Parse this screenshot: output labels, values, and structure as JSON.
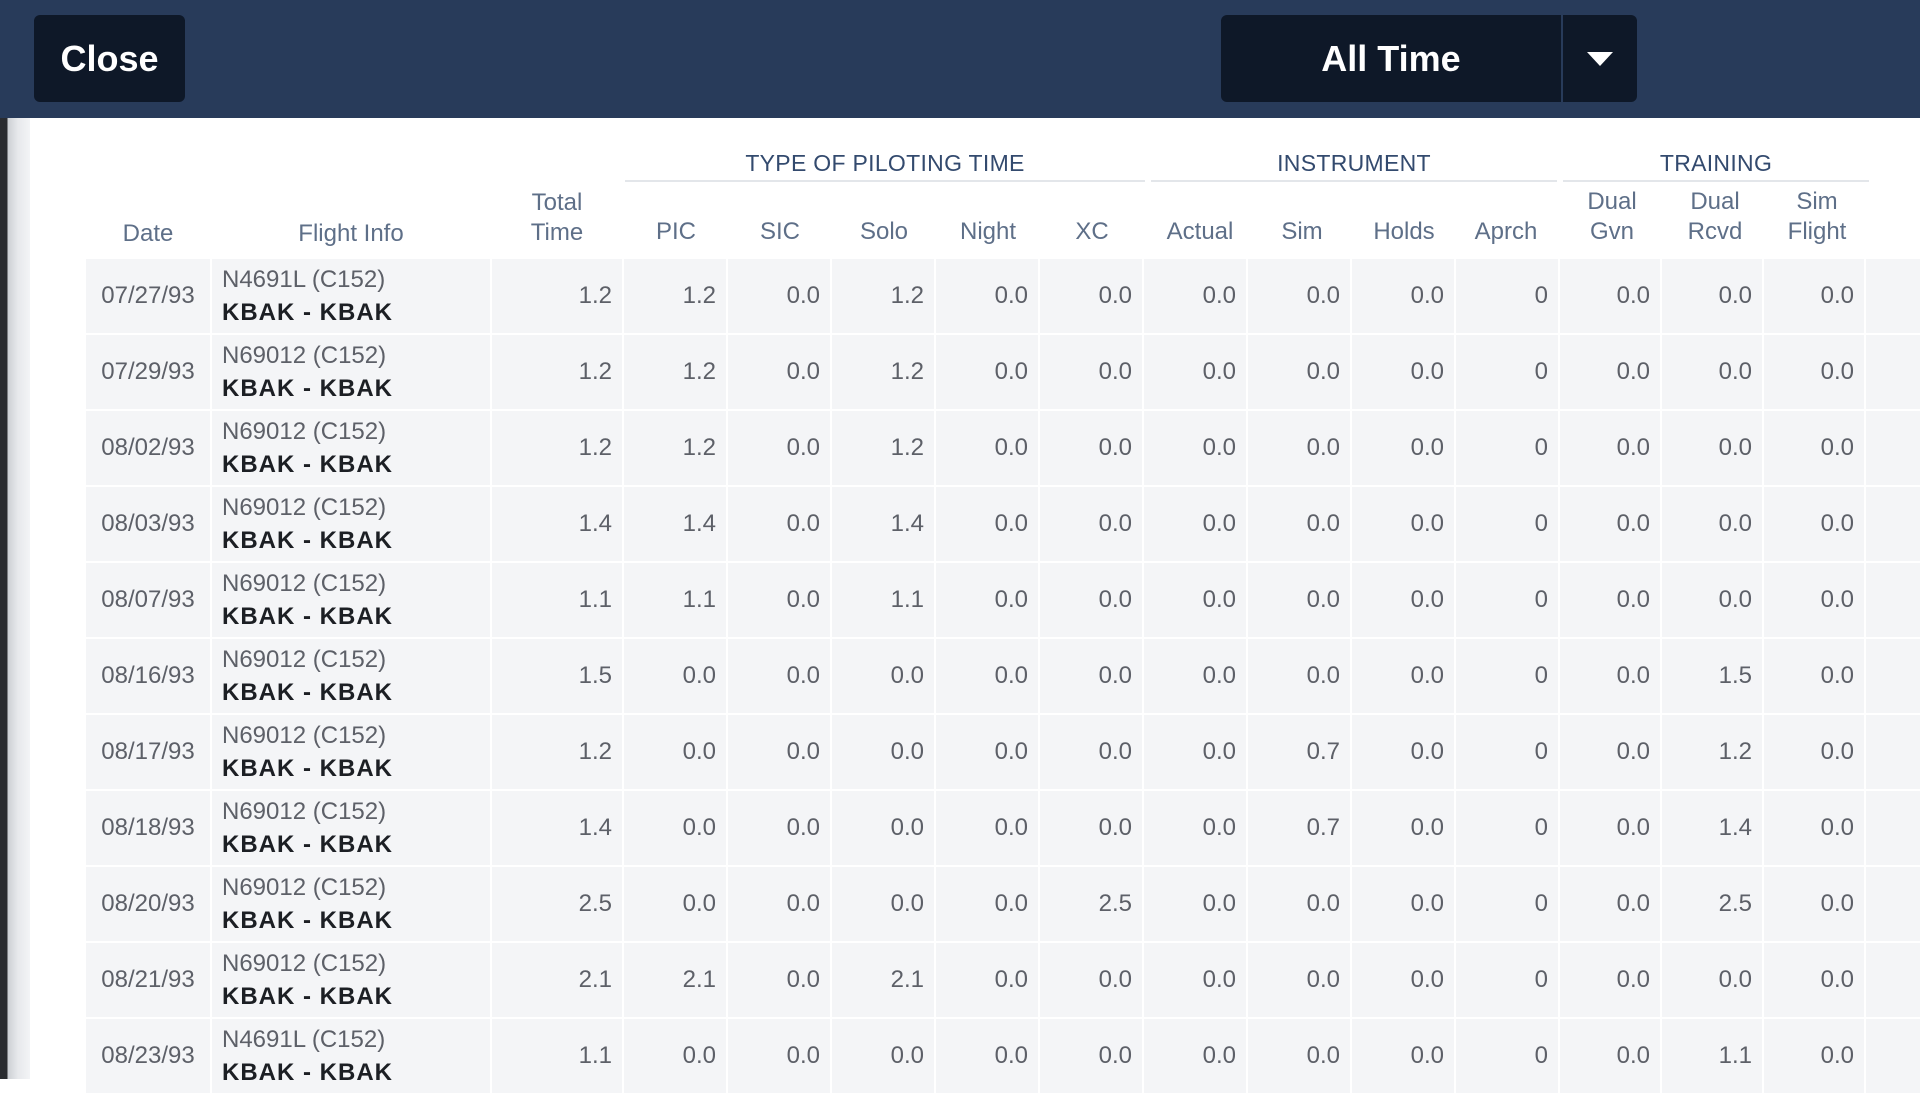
{
  "toolbar": {
    "close_label": "Close",
    "range_value": "All Time"
  },
  "colors": {
    "toolbar_bg": "#283b5a",
    "button_bg": "#0e1828",
    "header_text": "#334a6e",
    "row_bg": "#f4f5f7"
  },
  "groups": {
    "piloting": "TYPE OF PILOTING TIME",
    "instrument": "INSTRUMENT",
    "training": "TRAINING"
  },
  "columns": {
    "date": "Date",
    "flight_info": "Flight Info",
    "total_1": "Total",
    "total_2": "Time",
    "pic": "PIC",
    "sic": "SIC",
    "solo": "Solo",
    "night": "Night",
    "xc": "XC",
    "actual": "Actual",
    "sim": "Sim",
    "holds": "Holds",
    "aprch": "Aprch",
    "dual_gvn_1": "Dual",
    "dual_gvn_2": "Gvn",
    "dual_rcvd_1": "Dual",
    "dual_rcvd_2": "Rcvd",
    "sim_flight_1": "Sim",
    "sim_flight_2": "Flight"
  },
  "rows": [
    {
      "date": "07/27/93",
      "aircraft": "N4691L (C152)",
      "route": "KBAK - KBAK",
      "total": "1.2",
      "pic": "1.2",
      "sic": "0.0",
      "solo": "1.2",
      "night": "0.0",
      "xc": "0.0",
      "actual": "0.0",
      "sim": "0.0",
      "holds": "0.0",
      "aprch": "0",
      "dual_gvn": "0.0",
      "dual_rcvd": "0.0",
      "sim_flight": "0.0"
    },
    {
      "date": "07/29/93",
      "aircraft": "N69012 (C152)",
      "route": "KBAK - KBAK",
      "total": "1.2",
      "pic": "1.2",
      "sic": "0.0",
      "solo": "1.2",
      "night": "0.0",
      "xc": "0.0",
      "actual": "0.0",
      "sim": "0.0",
      "holds": "0.0",
      "aprch": "0",
      "dual_gvn": "0.0",
      "dual_rcvd": "0.0",
      "sim_flight": "0.0"
    },
    {
      "date": "08/02/93",
      "aircraft": "N69012 (C152)",
      "route": "KBAK - KBAK",
      "total": "1.2",
      "pic": "1.2",
      "sic": "0.0",
      "solo": "1.2",
      "night": "0.0",
      "xc": "0.0",
      "actual": "0.0",
      "sim": "0.0",
      "holds": "0.0",
      "aprch": "0",
      "dual_gvn": "0.0",
      "dual_rcvd": "0.0",
      "sim_flight": "0.0"
    },
    {
      "date": "08/03/93",
      "aircraft": "N69012 (C152)",
      "route": "KBAK - KBAK",
      "total": "1.4",
      "pic": "1.4",
      "sic": "0.0",
      "solo": "1.4",
      "night": "0.0",
      "xc": "0.0",
      "actual": "0.0",
      "sim": "0.0",
      "holds": "0.0",
      "aprch": "0",
      "dual_gvn": "0.0",
      "dual_rcvd": "0.0",
      "sim_flight": "0.0"
    },
    {
      "date": "08/07/93",
      "aircraft": "N69012 (C152)",
      "route": "KBAK - KBAK",
      "total": "1.1",
      "pic": "1.1",
      "sic": "0.0",
      "solo": "1.1",
      "night": "0.0",
      "xc": "0.0",
      "actual": "0.0",
      "sim": "0.0",
      "holds": "0.0",
      "aprch": "0",
      "dual_gvn": "0.0",
      "dual_rcvd": "0.0",
      "sim_flight": "0.0"
    },
    {
      "date": "08/16/93",
      "aircraft": "N69012 (C152)",
      "route": "KBAK - KBAK",
      "total": "1.5",
      "pic": "0.0",
      "sic": "0.0",
      "solo": "0.0",
      "night": "0.0",
      "xc": "0.0",
      "actual": "0.0",
      "sim": "0.0",
      "holds": "0.0",
      "aprch": "0",
      "dual_gvn": "0.0",
      "dual_rcvd": "1.5",
      "sim_flight": "0.0"
    },
    {
      "date": "08/17/93",
      "aircraft": "N69012 (C152)",
      "route": "KBAK - KBAK",
      "total": "1.2",
      "pic": "0.0",
      "sic": "0.0",
      "solo": "0.0",
      "night": "0.0",
      "xc": "0.0",
      "actual": "0.0",
      "sim": "0.7",
      "holds": "0.0",
      "aprch": "0",
      "dual_gvn": "0.0",
      "dual_rcvd": "1.2",
      "sim_flight": "0.0"
    },
    {
      "date": "08/18/93",
      "aircraft": "N69012 (C152)",
      "route": "KBAK - KBAK",
      "total": "1.4",
      "pic": "0.0",
      "sic": "0.0",
      "solo": "0.0",
      "night": "0.0",
      "xc": "0.0",
      "actual": "0.0",
      "sim": "0.7",
      "holds": "0.0",
      "aprch": "0",
      "dual_gvn": "0.0",
      "dual_rcvd": "1.4",
      "sim_flight": "0.0"
    },
    {
      "date": "08/20/93",
      "aircraft": "N69012 (C152)",
      "route": "KBAK - KBAK",
      "total": "2.5",
      "pic": "0.0",
      "sic": "0.0",
      "solo": "0.0",
      "night": "0.0",
      "xc": "2.5",
      "actual": "0.0",
      "sim": "0.0",
      "holds": "0.0",
      "aprch": "0",
      "dual_gvn": "0.0",
      "dual_rcvd": "2.5",
      "sim_flight": "0.0"
    },
    {
      "date": "08/21/93",
      "aircraft": "N69012 (C152)",
      "route": "KBAK - KBAK",
      "total": "2.1",
      "pic": "2.1",
      "sic": "0.0",
      "solo": "2.1",
      "night": "0.0",
      "xc": "0.0",
      "actual": "0.0",
      "sim": "0.0",
      "holds": "0.0",
      "aprch": "0",
      "dual_gvn": "0.0",
      "dual_rcvd": "0.0",
      "sim_flight": "0.0"
    },
    {
      "date": "08/23/93",
      "aircraft": "N4691L (C152)",
      "route": "KBAK - KBAK",
      "total": "1.1",
      "pic": "0.0",
      "sic": "0.0",
      "solo": "0.0",
      "night": "0.0",
      "xc": "0.0",
      "actual": "0.0",
      "sim": "0.0",
      "holds": "0.0",
      "aprch": "0",
      "dual_gvn": "0.0",
      "dual_rcvd": "1.1",
      "sim_flight": "0.0"
    }
  ]
}
